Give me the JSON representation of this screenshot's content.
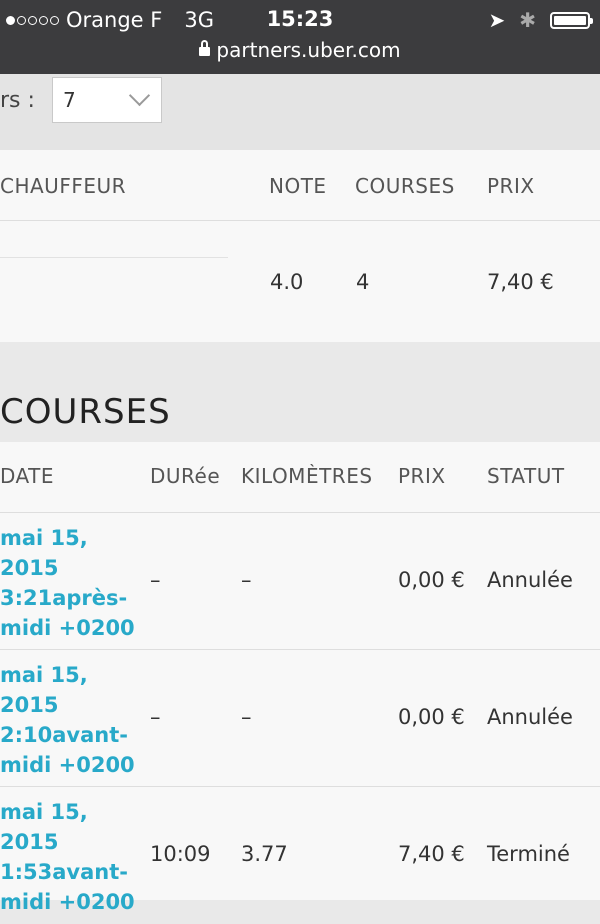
{
  "status_bar": {
    "carrier": "Orange F",
    "network": "3G",
    "time": "15:23",
    "location_glyph": "➤",
    "bluetooth_glyph": "✱",
    "url": "partners.uber.com",
    "signal_bars_filled": 1,
    "signal_bars_total": 5
  },
  "filter": {
    "label": "rs :",
    "selected_value": "7"
  },
  "drivers_table": {
    "headers": [
      "CHAUFFEUR",
      "NOTE",
      "COURSES",
      "PRIX"
    ],
    "rows": [
      {
        "chauffeur": "",
        "note": "4.0",
        "courses": "4",
        "prix": "7,40 €"
      }
    ]
  },
  "courses_section": {
    "title": "COURSES",
    "headers": [
      "DATE",
      "DURée",
      "KILOMÈTRES",
      "PRIX",
      "STATUT"
    ],
    "rows": [
      {
        "date": [
          "mai 15,",
          "2015",
          "3:21après-",
          "midi +0200"
        ],
        "duree": "–",
        "km": "–",
        "prix": "0,00 €",
        "statut": "Annulée"
      },
      {
        "date": [
          "mai 15,",
          "2015",
          "2:10avant-",
          "midi +0200"
        ],
        "duree": "–",
        "km": "–",
        "prix": "0,00 €",
        "statut": "Annulée"
      },
      {
        "date": [
          "mai 15,",
          "2015",
          "1:53avant-",
          "midi +0200"
        ],
        "duree": "10:09",
        "km": "3.77",
        "prix": "7,40 €",
        "statut": "Terminé"
      }
    ]
  },
  "colors": {
    "status_bar_bg": "#3c3c3e",
    "link_blue": "#28a9c9",
    "page_bg": "#e9e9e9",
    "panel_bg": "#f8f8f8"
  }
}
